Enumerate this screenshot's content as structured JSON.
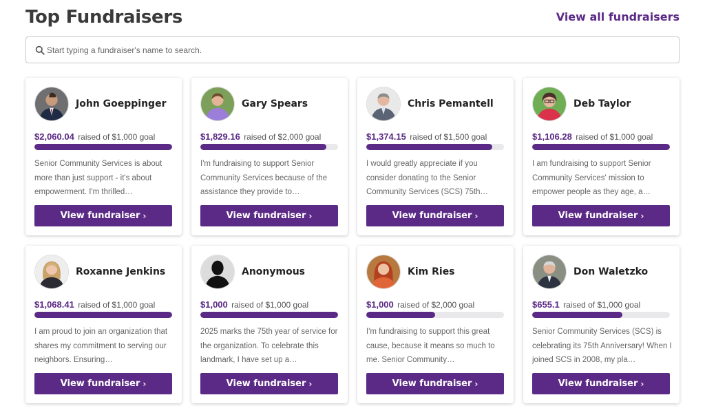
{
  "header": {
    "title": "Top Fundraisers",
    "view_all_label": "View all fundraisers"
  },
  "search": {
    "placeholder": "Start typing a fundraiser's name to search.",
    "icon": "search-icon"
  },
  "colors": {
    "accent": "#5b2a86",
    "track": "#e9e9ec"
  },
  "button_label": "View fundraiser",
  "button_chevron": "›",
  "raised_of": "raised of",
  "goal_word": "goal",
  "fundraisers": [
    {
      "name": "John Goeppinger",
      "amount": "$2,060.04",
      "goal": "$1,000",
      "progress": 1.0,
      "description": "Senior Community Services is about more than just support - it's about empowerment. I'm thrilled…",
      "avatar": "man-suit-avatar"
    },
    {
      "name": "Gary Spears",
      "amount": "$1,829.16",
      "goal": "$2,000",
      "progress": 0.915,
      "description": "I'm fundraising to support Senior Community Services because of the assistance they provide to…",
      "avatar": "man-purple-shirt-avatar"
    },
    {
      "name": "Chris Pemantell",
      "amount": "$1,374.15",
      "goal": "$1,500",
      "progress": 0.916,
      "description": "I would greatly appreciate if you consider donating to the Senior Community Services (SCS) 75th…",
      "avatar": "man-grey-suit-avatar"
    },
    {
      "name": "Deb Taylor",
      "amount": "$1,106.28",
      "goal": "$1,000",
      "progress": 1.0,
      "description": "I am fundraising to support Senior Community Services' mission to empower people as they age, a…",
      "avatar": "woman-glasses-avatar"
    },
    {
      "name": "Roxanne Jenkins",
      "amount": "$1,068.41",
      "goal": "$1,000",
      "progress": 1.0,
      "description": "I am proud to join an organization that shares my commitment to serving our neighbors. Ensuring…",
      "avatar": "woman-blonde-avatar"
    },
    {
      "name": "Anonymous",
      "amount": "$1,000",
      "goal": "$1,000",
      "progress": 1.0,
      "description": "2025 marks the 75th year of service for the organization. To celebrate this landmark, I have set up a…",
      "avatar": "anonymous-silhouette-avatar"
    },
    {
      "name": "Kim Ries",
      "amount": "$1,000",
      "goal": "$2,000",
      "progress": 0.5,
      "description": "I'm fundraising to support this great cause, because it means so much to me. Senior Community…",
      "avatar": "woman-red-hair-avatar"
    },
    {
      "name": "Don Waletzko",
      "amount": "$655.1",
      "goal": "$1,000",
      "progress": 0.655,
      "description": "Senior Community Services (SCS) is celebrating its 75th Anniversary! When I joined SCS in 2008, my pla…",
      "avatar": "man-grey-hair-avatar"
    }
  ]
}
